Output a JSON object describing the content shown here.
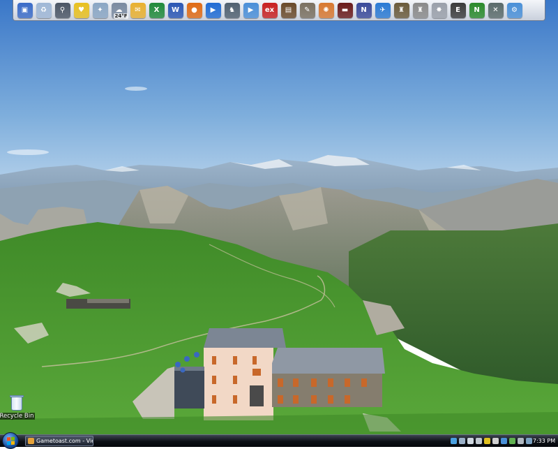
{
  "dock": {
    "icons": [
      {
        "name": "my-computer-icon",
        "color": "#3a6bc8",
        "glyph": "▣"
      },
      {
        "name": "recycle-bin-icon",
        "color": "#9fb7d6",
        "glyph": "♻"
      },
      {
        "name": "search-magnifier-icon",
        "color": "#4a5565",
        "glyph": "⚲"
      },
      {
        "name": "stethoscope-icon",
        "color": "#e8c020",
        "glyph": "♥"
      },
      {
        "name": "magic-wand-icon",
        "color": "#8aa6c4",
        "glyph": "✦"
      },
      {
        "name": "weather-icon",
        "color": "#7a8aa0",
        "glyph": "☁",
        "sub": "24°F"
      },
      {
        "name": "outlook-icon",
        "color": "#e8b030",
        "glyph": "✉"
      },
      {
        "name": "excel-icon",
        "color": "#1f8a3a",
        "glyph": "X"
      },
      {
        "name": "word-icon",
        "color": "#2a56b4",
        "glyph": "W"
      },
      {
        "name": "firefox-icon",
        "color": "#e06a14",
        "glyph": "●"
      },
      {
        "name": "media-player-icon",
        "color": "#1f6bd4",
        "glyph": "▶"
      },
      {
        "name": "oracle-figure-icon",
        "color": "#506070",
        "glyph": "♞"
      },
      {
        "name": "play-disc-icon",
        "color": "#4a8fd8",
        "glyph": "▶"
      },
      {
        "name": "excel-game-icon",
        "color": "#c82020",
        "glyph": "ex"
      },
      {
        "name": "photo-viewer-icon",
        "color": "#6a4a2a",
        "glyph": "▤"
      },
      {
        "name": "gimp-icon",
        "color": "#7a7060",
        "glyph": "✎"
      },
      {
        "name": "picasa-icon",
        "color": "#d87830",
        "glyph": "✺"
      },
      {
        "name": "race-car-icon",
        "color": "#6a1a1a",
        "glyph": "▬"
      },
      {
        "name": "nascar-icon",
        "color": "#3a4a9a",
        "glyph": "N"
      },
      {
        "name": "flight-simulator-icon",
        "color": "#2a7ad4",
        "glyph": "✈"
      },
      {
        "name": "battlefront-icon",
        "color": "#6a5a3a",
        "glyph": "♜"
      },
      {
        "name": "at-at-walker-icon",
        "color": "#8a8a8a",
        "glyph": "♜"
      },
      {
        "name": "starfighter-icon",
        "color": "#9aa0aa",
        "glyph": "✸"
      },
      {
        "name": "battlefield-e-icon",
        "color": "#3a3a3a",
        "glyph": "E"
      },
      {
        "name": "n64-emulator-icon",
        "color": "#2a8a2a",
        "glyph": "N"
      },
      {
        "name": "xbox-icon",
        "color": "#5a6a6a",
        "glyph": "✕"
      },
      {
        "name": "settings-gears-icon",
        "color": "#4a90d8",
        "glyph": "⚙"
      }
    ]
  },
  "desktop": {
    "recycle_bin_label": "Recycle Bin"
  },
  "taskbar": {
    "task_label": "Gametoast.com - View...",
    "clock": "7:33 PM",
    "tray_icons": [
      {
        "name": "network-tray-icon",
        "color": "#4aa0e0"
      },
      {
        "name": "monitor-tray-icon",
        "color": "#9ab0c8"
      },
      {
        "name": "screen-tray-icon",
        "color": "#d0d8e0"
      },
      {
        "name": "volume-tray-icon",
        "color": "#c0c8d0"
      },
      {
        "name": "antivirus-tray-icon",
        "color": "#e0c020"
      },
      {
        "name": "shield-tray-icon",
        "color": "#d0d0d0"
      },
      {
        "name": "update-tray-icon",
        "color": "#4a90d8"
      },
      {
        "name": "chat-tray-icon",
        "color": "#60b050"
      },
      {
        "name": "audio-tray-icon",
        "color": "#b0b8c0"
      },
      {
        "name": "power-tray-icon",
        "color": "#7aa0c0"
      }
    ]
  },
  "colors": {
    "sky_top": "#3a77c8",
    "sky_bottom": "#b7d3ec",
    "grass": "#4f9a32"
  }
}
